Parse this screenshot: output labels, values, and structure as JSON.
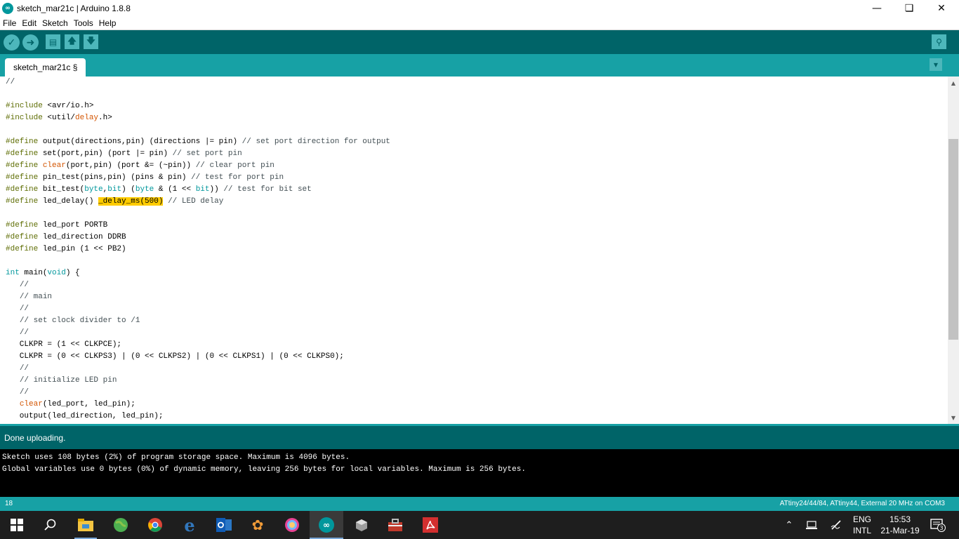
{
  "window": {
    "title": "sketch_mar21c | Arduino 1.8.8",
    "app_icon": "arduino-icon",
    "controls": [
      "minimize",
      "maximize",
      "close"
    ]
  },
  "menu": [
    "File",
    "Edit",
    "Sketch",
    "Tools",
    "Help"
  ],
  "toolbar": {
    "buttons": [
      "verify",
      "upload",
      "new",
      "open",
      "save"
    ],
    "serial_monitor": "serial-monitor-icon"
  },
  "tabs": [
    {
      "label": "sketch_mar21c §",
      "active": true
    }
  ],
  "editor": {
    "highlighted_token": "_delay_ms(500)",
    "lines": [
      "//",
      "",
      "#include <avr/io.h>",
      "#include <util/delay.h>",
      "",
      "#define output(directions,pin) (directions |= pin) // set port direction for output",
      "#define set(port,pin) (port |= pin) // set port pin",
      "#define clear(port,pin) (port &= (~pin)) // clear port pin",
      "#define pin_test(pins,pin) (pins & pin) // test for port pin",
      "#define bit_test(byte,bit) (byte & (1 << bit)) // test for bit set",
      "#define led_delay() _delay_ms(500) // LED delay",
      "",
      "#define led_port PORTB",
      "#define led_direction DDRB",
      "#define led_pin (1 << PB2)",
      "",
      "int main(void) {",
      "   //",
      "   // main",
      "   //",
      "   // set clock divider to /1",
      "   //",
      "   CLKPR = (1 << CLKPCE);",
      "   CLKPR = (0 << CLKPS3) | (0 << CLKPS2) | (0 << CLKPS1) | (0 << CLKPS0);",
      "   //",
      "   // initialize LED pin",
      "   //",
      "   clear(led_port, led_pin);",
      "   output(led_direction, led_pin);"
    ]
  },
  "status": {
    "message": "Done uploading."
  },
  "console": {
    "lines": [
      "Sketch uses 108 bytes (2%) of program storage space. Maximum is 4096 bytes.",
      "Global variables use 0 bytes (0%) of dynamic memory, leaving 256 bytes for local variables. Maximum is 256 bytes."
    ]
  },
  "footer": {
    "line_number": "18",
    "board": "ATtiny24/44/84, ATtiny44, External 20 MHz on COM3"
  },
  "taskbar": {
    "apps": [
      "file-explorer-icon",
      "network-globe-icon",
      "chrome-icon",
      "edge-icon",
      "outlook-icon",
      "bird-app-icon",
      "paint-icon",
      "arduino-icon",
      "sketchup-icon",
      "toolbox-icon",
      "acrobat-icon"
    ],
    "language_top": "ENG",
    "language_bottom": "INTL",
    "time": "15:53",
    "date": "21-Mar-19",
    "notifications": "3"
  },
  "colors": {
    "toolbar_dark": "#006468",
    "tab_teal": "#17a1a5",
    "button_light": "#4db7bb",
    "highlight": "#ffcc00",
    "keyword": "#5e6d03",
    "type": "#00979c",
    "function": "#d35400",
    "comment": "#434f54"
  }
}
